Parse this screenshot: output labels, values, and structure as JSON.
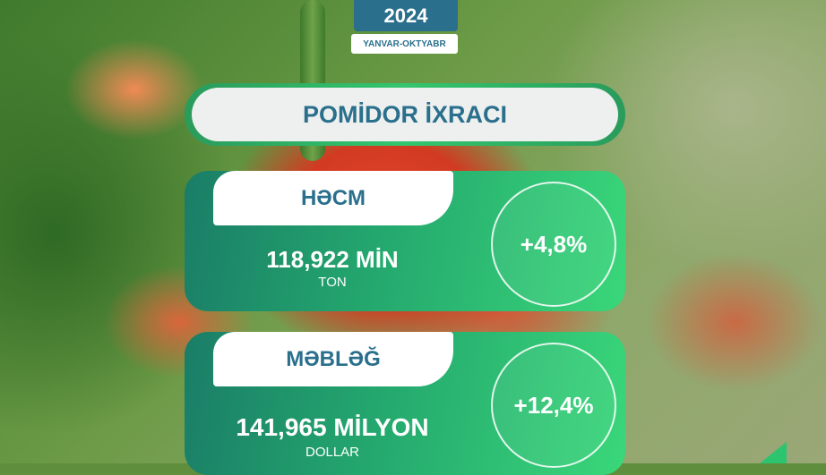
{
  "header": {
    "year": "2024",
    "period": "YANVAR-OKTYABR"
  },
  "title": "POMİDOR İXRACI",
  "cards": [
    {
      "label": "HƏCM",
      "value": "118,922 MİN",
      "unit": "TON",
      "change": "+4,8%"
    },
    {
      "label": "MƏBLƏĞ",
      "value": "141,965 MİLYON",
      "unit": "DOLLAR",
      "change": "+12,4%"
    }
  ],
  "colors": {
    "brand_blue": "#2a6f8c",
    "card_green_start": "#1a7d67",
    "card_green_end": "#3ad77a",
    "pill_background": "#eef0ef"
  },
  "background": {
    "icon": "tomato-plant-photo"
  }
}
